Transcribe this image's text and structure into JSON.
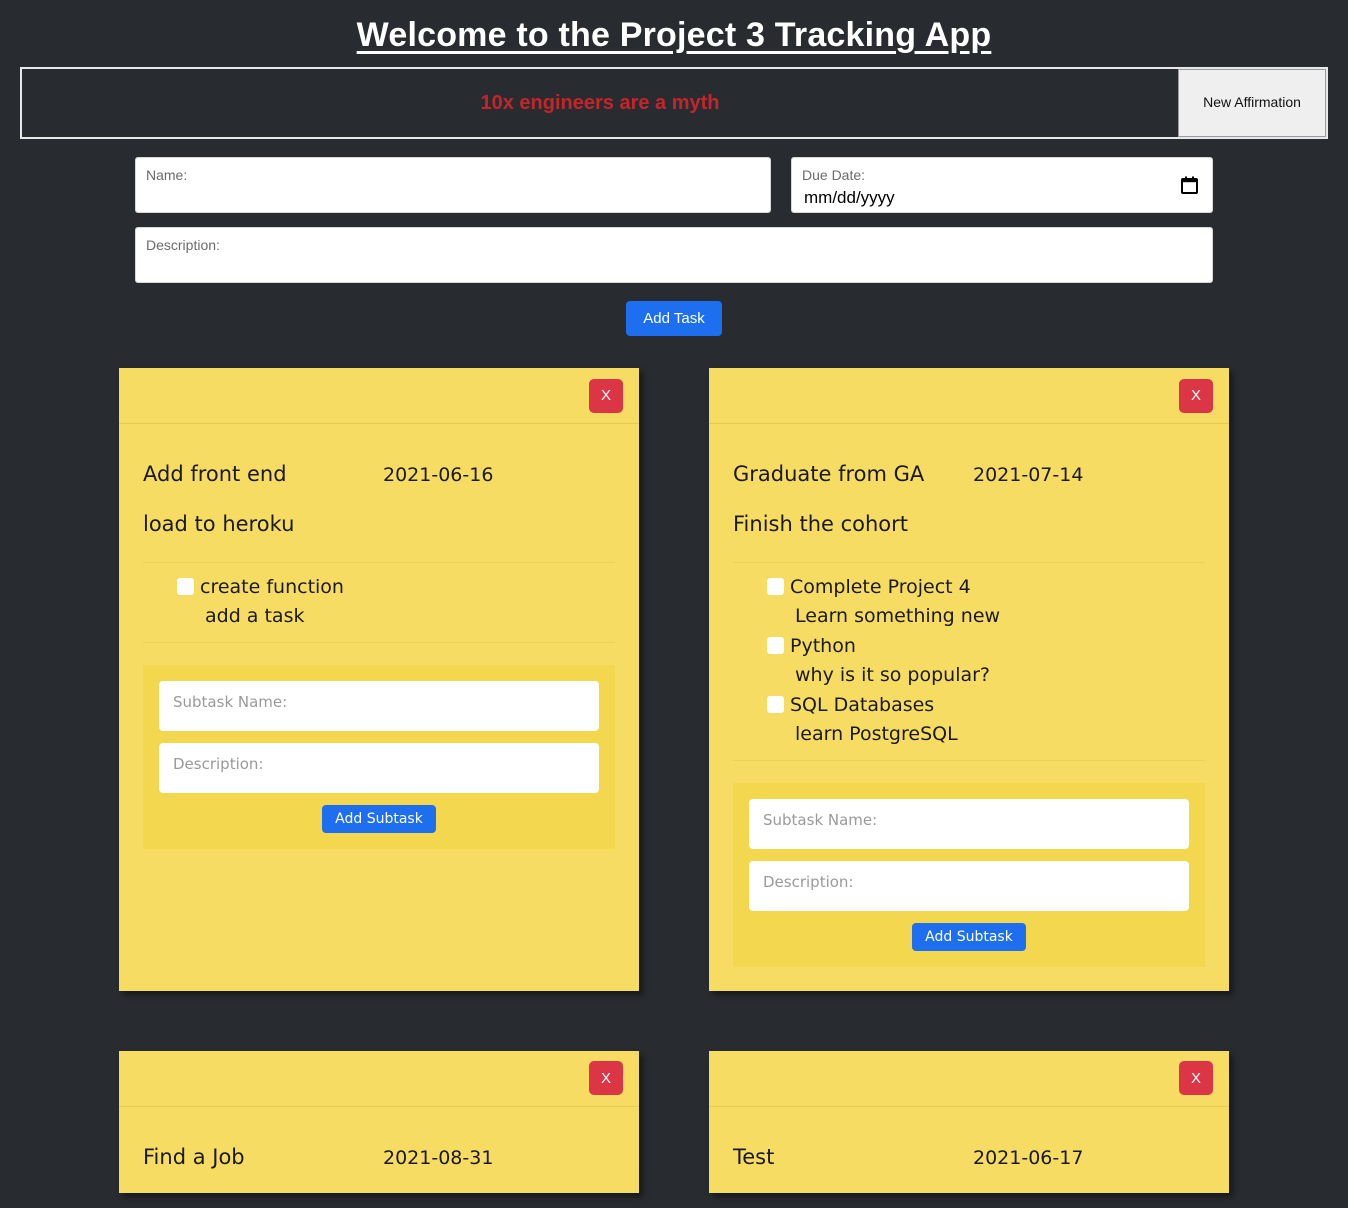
{
  "header": {
    "title": "Welcome to the Project 3 Tracking App",
    "affirmation": "10x engineers are a myth",
    "affirmation_color": "#c4252b",
    "new_affirmation_label": "New Affirmation"
  },
  "task_form": {
    "name_placeholder": "Name:",
    "due_date_placeholder": "Due Date:",
    "due_date_value": "mm/dd/yyyy",
    "description_placeholder": "Description:",
    "add_task_label": "Add Task",
    "calendar_icon": "calendar-icon"
  },
  "common": {
    "close_label": "X",
    "subtask_name_placeholder": "Subtask Name:",
    "subtask_description_placeholder": "Description:",
    "add_subtask_label": "Add Subtask"
  },
  "colors": {
    "page_background": "#282c30",
    "card_background": "#f7dc64",
    "subform_background": "#f3d74f",
    "primary_button": "#1e6ff0",
    "danger_button": "#dc3545",
    "title_text": "#ffffff"
  },
  "cards": [
    {
      "title": "Add front end",
      "date": "2021-06-16",
      "description": "load to heroku",
      "subtasks": [
        {
          "name": "create function",
          "description": "add a task",
          "checked": false
        }
      ],
      "has_subform": true
    },
    {
      "title": "Graduate from GA",
      "date": "2021-07-14",
      "description": "Finish the cohort",
      "subtasks": [
        {
          "name": "Complete Project 4",
          "description": "Learn something new",
          "checked": false
        },
        {
          "name": "Python",
          "description": "why is it so popular?",
          "checked": false
        },
        {
          "name": "SQL Databases",
          "description": "learn PostgreSQL",
          "checked": false
        }
      ],
      "has_subform": true
    },
    {
      "title": "Find a Job",
      "date": "2021-08-31",
      "description": "",
      "subtasks": [],
      "has_subform": false
    },
    {
      "title": "Test",
      "date": "2021-06-17",
      "description": "",
      "subtasks": [],
      "has_subform": false
    }
  ]
}
